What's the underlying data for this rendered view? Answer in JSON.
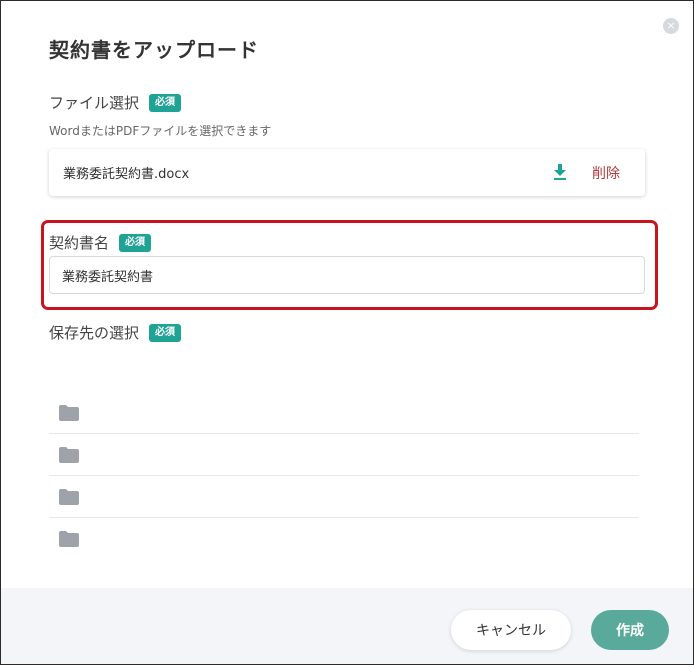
{
  "dialog": {
    "title": "契約書をアップロード",
    "close_icon": "×"
  },
  "file_section": {
    "label": "ファイル選択",
    "required_badge": "必須",
    "hint": "WordまたはPDFファイルを選択できます",
    "file_name": "業務委託契約書.docx",
    "download_icon": "download-icon",
    "delete_label": "削除"
  },
  "name_section": {
    "label": "契約書名",
    "required_badge": "必須",
    "value": "業務委託契約書"
  },
  "destination_section": {
    "label": "保存先の選択",
    "required_badge": "必須",
    "folder_icon": "folder-icon",
    "folders": [
      "",
      "",
      "",
      ""
    ]
  },
  "footer": {
    "cancel_label": "キャンセル",
    "create_label": "作成"
  },
  "colors": {
    "accent": "#1fa394",
    "primary_button": "#5aaa9c",
    "delete": "#b23b3b",
    "highlight": "#c8141e"
  }
}
